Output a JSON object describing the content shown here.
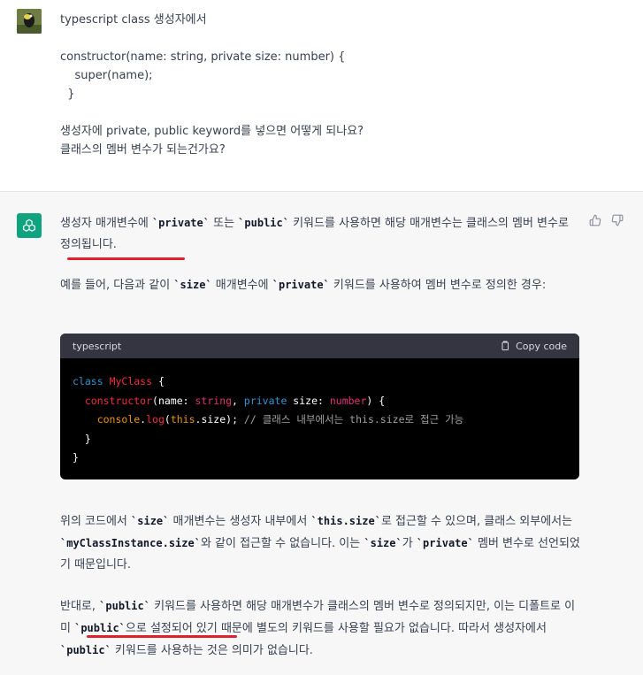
{
  "user_message": {
    "line1": "typescript class 생성자에서",
    "code1": "constructor(name: string, private size: number) {",
    "code2": "    super(name);",
    "code3": "  }",
    "line2": "생성자에 private, public keyword를 넣으면 어떻게 되나요?",
    "line3": "클래스의 멤버 변수가 되는건가요?"
  },
  "assistant": {
    "p1_a": "생성자 매개변수에 ",
    "p1_code1": "`private`",
    "p1_b": " 또는 ",
    "p1_code2": "`public`",
    "p1_c": " 키워드를 사용하면 해당 매개변수는 클래스의 멤버 변수로 정의됩니다.",
    "p2_a": "예를 들어, 다음과 같이 ",
    "p2_code1": "`size`",
    "p2_b": " 매개변수에 ",
    "p2_code2": "`private`",
    "p2_c": " 키워드를 사용하여 멤버 변수로 정의한 경우:",
    "code_block": {
      "language": "typescript",
      "copy_label": "Copy code",
      "comment": "// 클래스 내부에서는 this.size로 접근 가능"
    },
    "p3_a": "위의 코드에서 ",
    "p3_code1": "`size`",
    "p3_b": " 매개변수는 생성자 내부에서 ",
    "p3_code2": "`this.size`",
    "p3_c": "로 접근할 수 있으며, 클래스 외부에서는 ",
    "p3_code3": "`myClassInstance.size`",
    "p3_d": "와 같이 접근할 수 없습니다. 이는 ",
    "p3_code4": "`size`",
    "p3_e": "가 ",
    "p3_code5": "`private`",
    "p3_f": " 멤버 변수로 선언되었기 때문입니다.",
    "p4_a": "반대로, ",
    "p4_code1": "`public`",
    "p4_b": " 키워드를 사용하면 해당 매개변수가 클래스의 멤버 변수로 정의되지만, 이는 디폴트로 이미 ",
    "p4_code2": "`public`",
    "p4_c": "으로 설정되어 있기 때문에 별도의 키워드를 사용할 필요가 없습니다. 따라서 생성자에서 ",
    "p4_code3": "`public`",
    "p4_d": " 키워드를 사용하는 것은 의미가 없습니다."
  },
  "colors": {
    "accent_green": "#10a37f",
    "underline_red": "#e0202b"
  }
}
